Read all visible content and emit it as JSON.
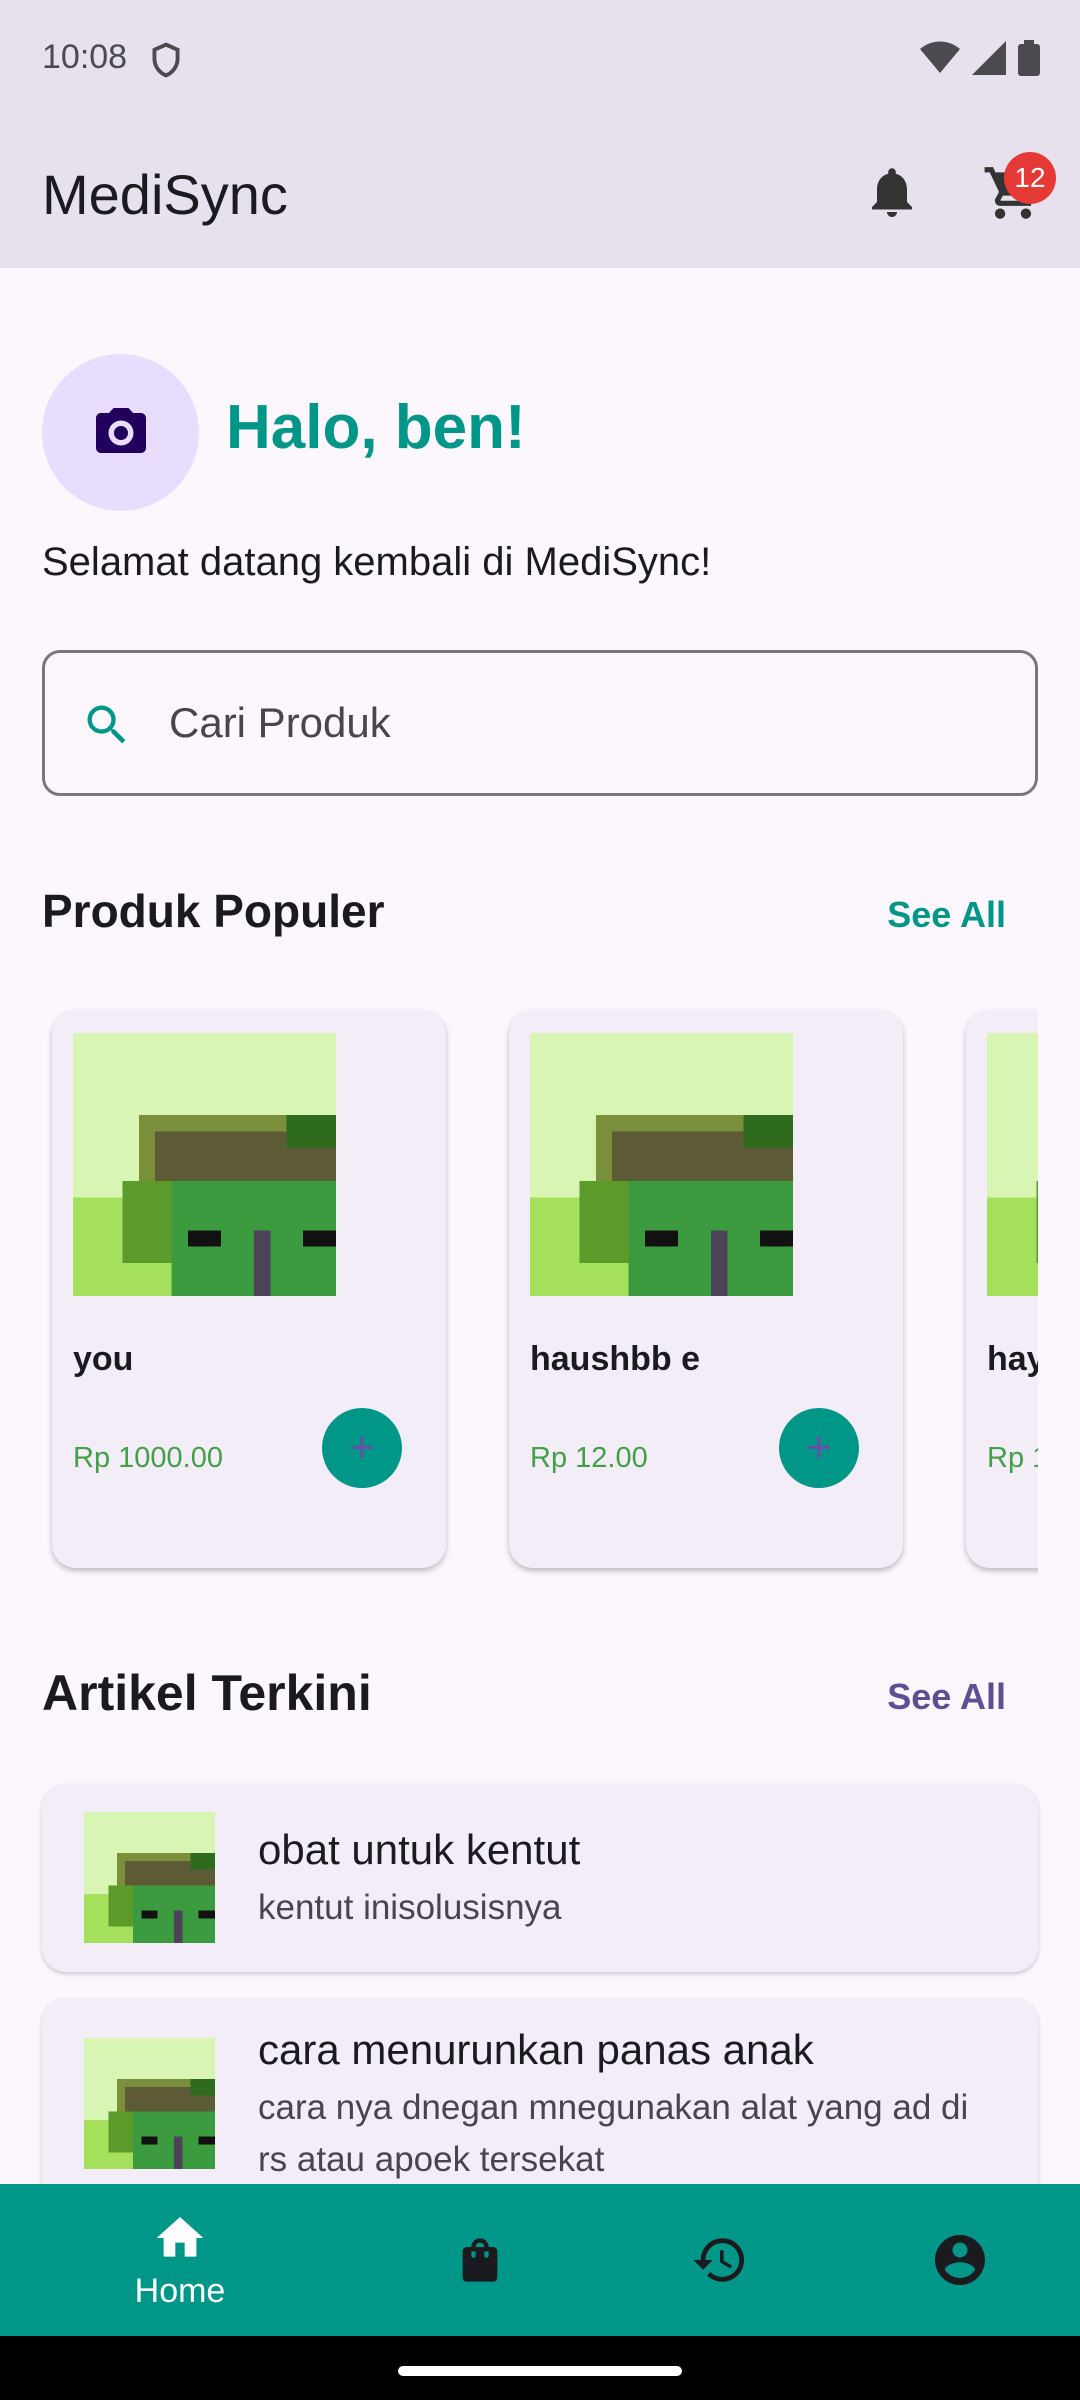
{
  "status_bar": {
    "time": "10:08",
    "icons": [
      "shield-icon",
      "wifi-icon",
      "signal-icon",
      "battery-icon"
    ]
  },
  "app_bar": {
    "title": "MediSync",
    "cart_badge": "12",
    "icons": [
      "bell-icon",
      "cart-icon"
    ]
  },
  "profile": {
    "greeting": "Halo, ben!",
    "welcome": "Selamat datang kembali di MediSync!",
    "avatar_icon": "camera-icon"
  },
  "search": {
    "placeholder": "Cari Produk",
    "value": ""
  },
  "popular": {
    "title": "Produk Populer",
    "see_all": "See All",
    "products": [
      {
        "name": "you",
        "price": "Rp 1000.00"
      },
      {
        "name": "haushbb e",
        "price": "Rp 12.00"
      },
      {
        "name": "hay",
        "price": "Rp 1"
      }
    ]
  },
  "articles": {
    "title": "Artikel Terkini",
    "see_all": "See All",
    "items": [
      {
        "title": "obat untuk kentut",
        "subtitle": "kentut inisolusisnya"
      },
      {
        "title": "cara menurunkan panas anak",
        "subtitle": "cara nya dnegan mnegunakan alat yang ad di rs atau apoek tersekat"
      }
    ]
  },
  "bottom_nav": {
    "items": [
      {
        "label": "Home",
        "icon": "home-icon",
        "active": true
      },
      {
        "label": "",
        "icon": "shopping-bag-icon"
      },
      {
        "label": "",
        "icon": "history-icon"
      },
      {
        "label": "",
        "icon": "account-icon"
      }
    ]
  },
  "colors": {
    "primary": "#009688",
    "app_bar": "#e7e1ee",
    "price": "#43a047",
    "article_see_all": "#5e4e94",
    "badge": "#e53935"
  }
}
